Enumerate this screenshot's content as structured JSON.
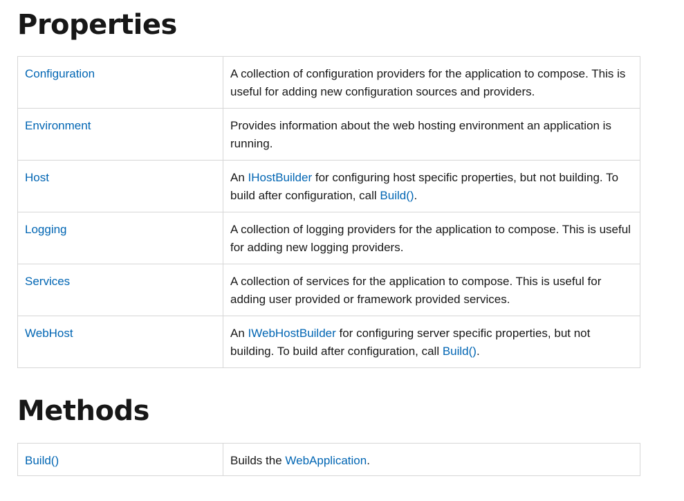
{
  "properties": {
    "heading": "Properties",
    "rows": [
      {
        "name": "Configuration",
        "desc": [
          {
            "text": "A collection of configuration providers for the application to compose. This is useful for adding new configuration sources and providers."
          }
        ]
      },
      {
        "name": "Environment",
        "desc": [
          {
            "text": "Provides information about the web hosting environment an application is running."
          }
        ]
      },
      {
        "name": "Host",
        "desc": [
          {
            "text": "An "
          },
          {
            "text": "IHostBuilder",
            "link": true
          },
          {
            "text": " for configuring host specific properties, but not building. To build after configuration, call "
          },
          {
            "text": "Build()",
            "link": true
          },
          {
            "text": "."
          }
        ]
      },
      {
        "name": "Logging",
        "desc": [
          {
            "text": "A collection of logging providers for the application to compose. This is useful for adding new logging providers."
          }
        ]
      },
      {
        "name": "Services",
        "desc": [
          {
            "text": "A collection of services for the application to compose. This is useful for adding user provided or framework provided services."
          }
        ]
      },
      {
        "name": "WebHost",
        "desc": [
          {
            "text": "An "
          },
          {
            "text": "IWebHostBuilder",
            "link": true
          },
          {
            "text": " for configuring server specific properties, but not building. To build after configuration, call "
          },
          {
            "text": "Build()",
            "link": true
          },
          {
            "text": "."
          }
        ]
      }
    ]
  },
  "methods": {
    "heading": "Methods",
    "rows": [
      {
        "name": "Build()",
        "desc": [
          {
            "text": "Builds the "
          },
          {
            "text": "WebApplication",
            "link": true
          },
          {
            "text": "."
          }
        ]
      }
    ]
  },
  "colors": {
    "link": "#0065b3",
    "text": "#171717",
    "border": "#d6d6d6"
  }
}
